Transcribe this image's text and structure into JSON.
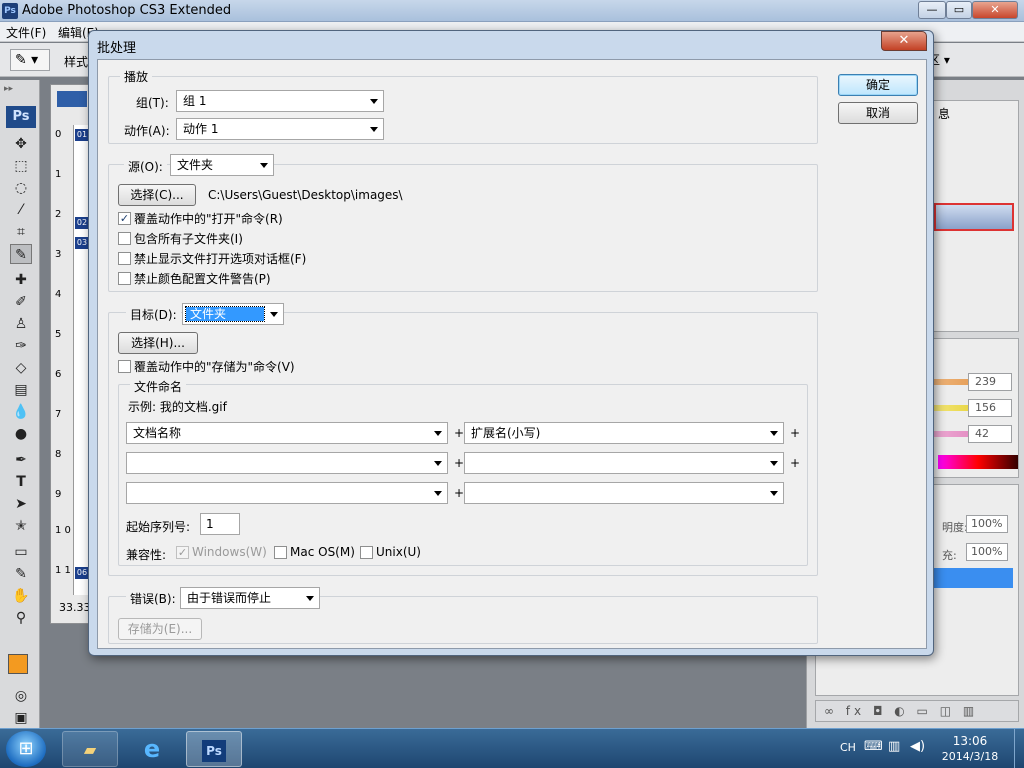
{
  "photoshop": {
    "title": "Adobe Photoshop CS3 Extended",
    "logo": "Ps",
    "window_controls": {
      "minimize": "—",
      "maximize": "▭",
      "close": "✕"
    },
    "menu": [
      {
        "label": "文件(F)"
      },
      {
        "label": "编辑(E)"
      }
    ],
    "options_bar": {
      "tool_icon": "eyedropper-icon",
      "style_label": "样式",
      "right_label": "区 ▾"
    },
    "toolbox_badge": "Ps",
    "document": {
      "zoom": "33.33",
      "ruler_numbers": [
        "0",
        "1",
        "2",
        "3",
        "4",
        "5",
        "6",
        "7",
        "8",
        "9",
        "1\n0",
        "1\n1"
      ],
      "track_marks": [
        "01",
        "02",
        "03",
        "06"
      ]
    },
    "panels": {
      "tab_label": "息",
      "color_values": [
        "239",
        "156",
        "42"
      ],
      "opacity_label": "明度:",
      "opacity_value": "100%",
      "fill_label": "充:",
      "fill_value": "100%",
      "bottom_icons": "∞ fx ◘ ◐ ▭ ◫ ▥"
    }
  },
  "dialog": {
    "title": "批处理",
    "close_icon": "✕",
    "ok_label": "确定",
    "cancel_label": "取消",
    "play": {
      "group_label": "播放",
      "set_label": "组(T):",
      "set_value": "组 1",
      "action_label": "动作(A):",
      "action_value": "动作 1"
    },
    "source": {
      "label": "源(O):",
      "value": "文件夹",
      "choose_label": "选择(C)...",
      "path": "C:\\Users\\Guest\\Desktop\\images\\",
      "options": [
        {
          "label": "覆盖动作中的\"打开\"命令(R)",
          "checked": true
        },
        {
          "label": "包含所有子文件夹(I)",
          "checked": false
        },
        {
          "label": "禁止显示文件打开选项对话框(F)",
          "checked": false
        },
        {
          "label": "禁止颜色配置文件警告(P)",
          "checked": false
        }
      ]
    },
    "destination": {
      "label": "目标(D):",
      "value": "文件夹",
      "choose_label": "选择(H)...",
      "override_label": "覆盖动作中的\"存储为\"命令(V)",
      "override_checked": false,
      "naming": {
        "group_label": "文件命名",
        "example": "示例: 我的文档.gif",
        "rows": [
          {
            "left": "文档名称",
            "right": "扩展名(小写)"
          },
          {
            "left": "",
            "right": ""
          },
          {
            "left": "",
            "right": ""
          }
        ],
        "plus": "+",
        "serial_label": "起始序列号:",
        "serial_value": "1",
        "compat_label": "兼容性:",
        "compat": [
          {
            "label": "Windows(W)",
            "checked": true,
            "disabled": true
          },
          {
            "label": "Mac OS(M)",
            "checked": false,
            "disabled": false
          },
          {
            "label": "Unix(U)",
            "checked": false,
            "disabled": false
          }
        ]
      }
    },
    "errors": {
      "label": "错误(B):",
      "value": "由于错误而停止",
      "save_as_label": "存储为(E)..."
    }
  },
  "taskbar": {
    "start_icon": "windows-start-icon",
    "ie_glyph": "e",
    "ps_label": "Ps",
    "lang": "CH",
    "time": "13:06",
    "date": "2014/3/18"
  }
}
